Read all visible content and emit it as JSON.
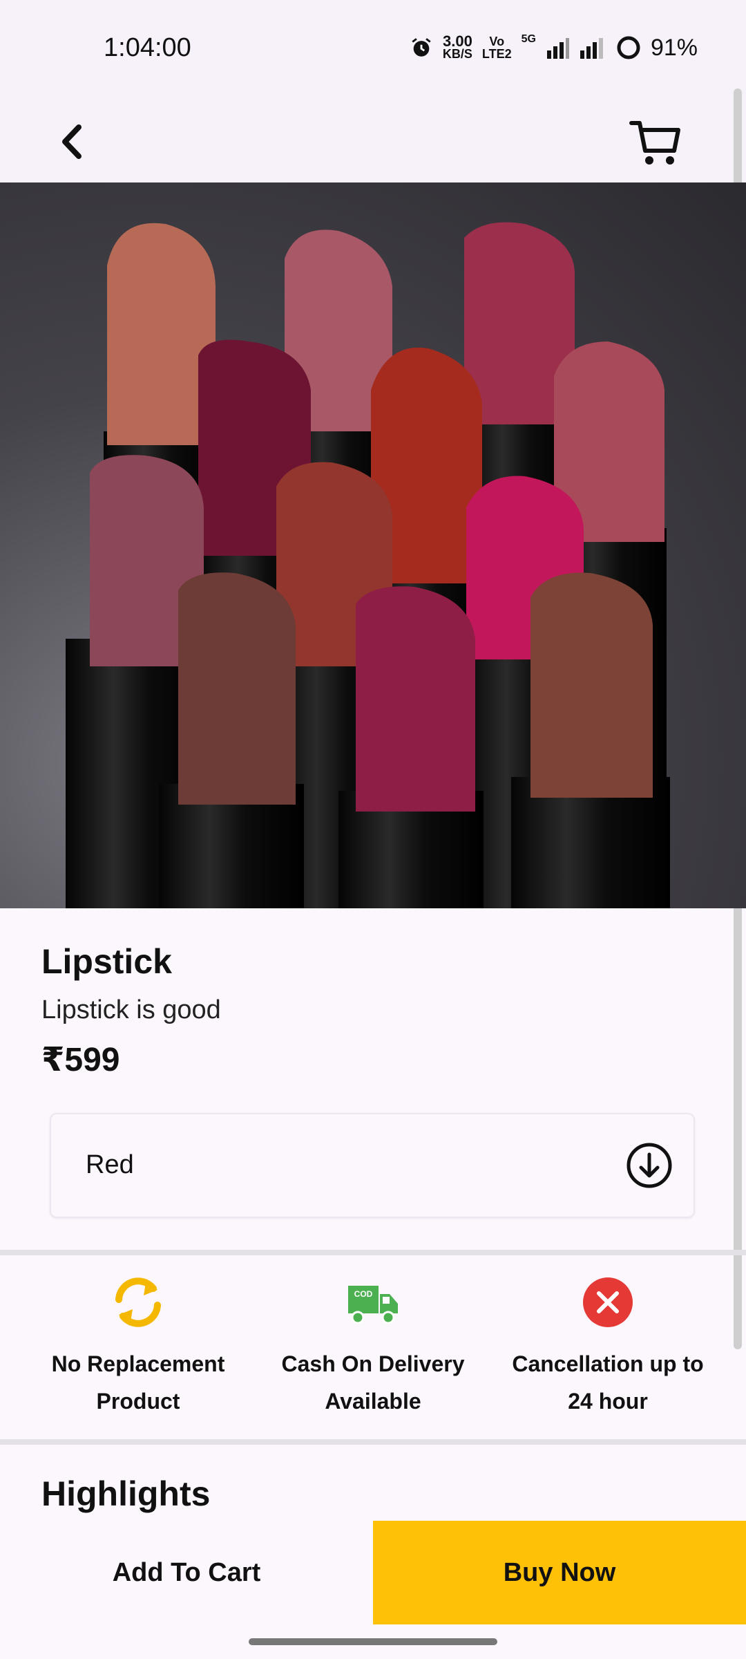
{
  "status_bar": {
    "time": "1:04:00",
    "net_speed_value": "3.00",
    "net_speed_unit": "KB/S",
    "volte_top": "Vo",
    "volte_bottom": "LTE2",
    "network_type": "5G",
    "battery": "91%"
  },
  "app_bar": {
    "back_icon": "chevron-left-icon",
    "cart_icon": "cart-icon"
  },
  "product": {
    "name": "Lipstick",
    "description": "Lipstick is good",
    "price": "₹599",
    "selected_variant": "Red"
  },
  "features": [
    {
      "icon": "replace-icon",
      "line1": "No Replacement",
      "line2": "Product"
    },
    {
      "icon": "cod-truck-icon",
      "icon_text": "COD",
      "line1": "Cash On Delivery",
      "line2": "Available"
    },
    {
      "icon": "cancel-icon",
      "line1": "Cancellation up to",
      "line2": "24 hour"
    }
  ],
  "highlights_title": "Highlights",
  "actions": {
    "add_to_cart": "Add To Cart",
    "buy_now": "Buy Now"
  },
  "colors": {
    "accent": "#ffc107",
    "replace_icon": "#f5b800",
    "cod_icon": "#4caf50",
    "cancel_icon": "#e53935"
  }
}
